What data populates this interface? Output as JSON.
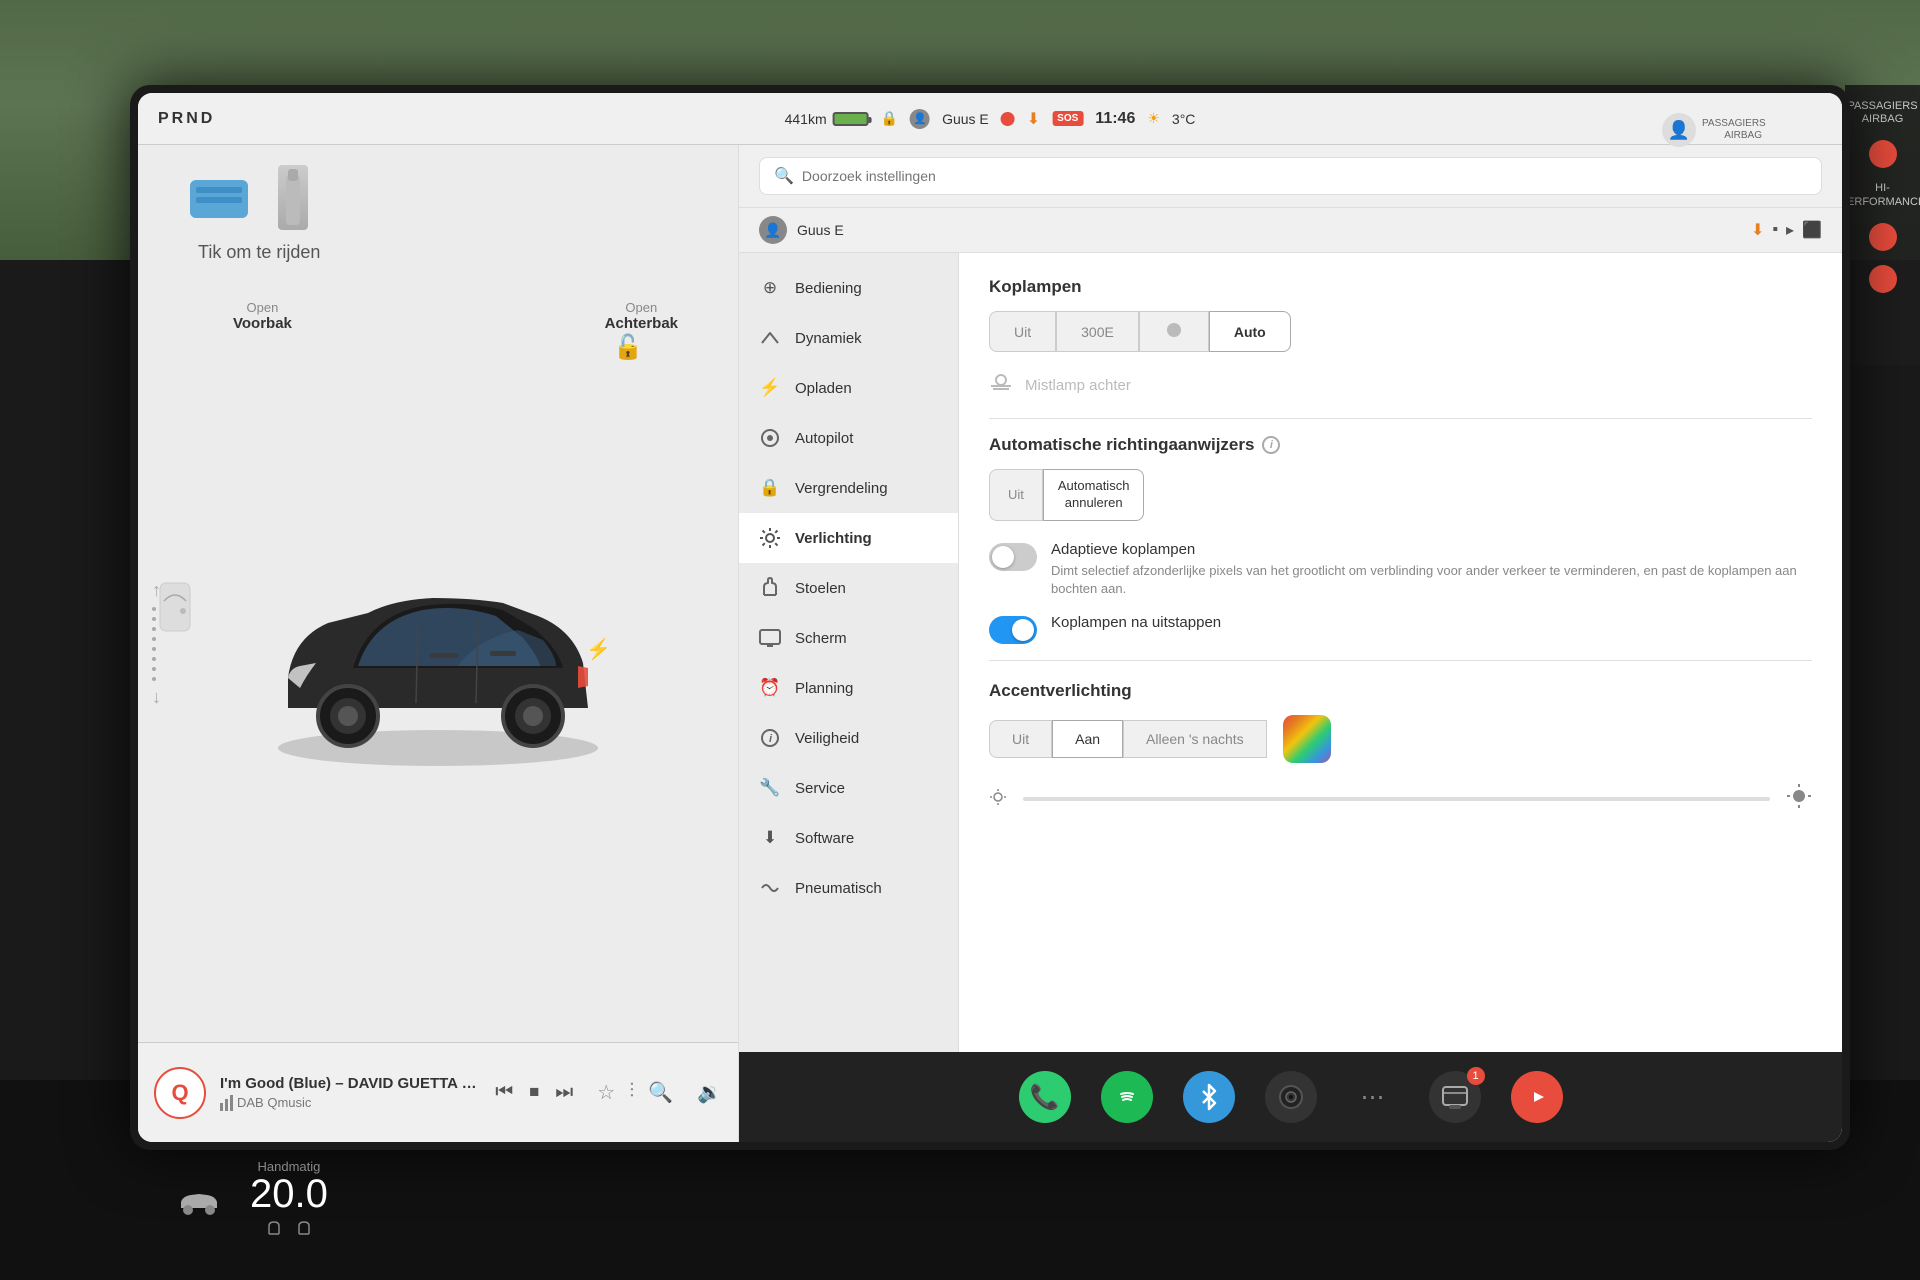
{
  "status_bar": {
    "prnd": "PRND",
    "range": "441km",
    "user": "Guus E",
    "time": "11:46",
    "temp": "3°C"
  },
  "car_panel": {
    "tik_om_te_rijden": "Tik om te rijden",
    "open_voorbak": "Open",
    "voorbak": "Voorbak",
    "open_achterbak": "Open",
    "achterbak": "Achterbak"
  },
  "music": {
    "title": "I'm Good (Blue) – DAVID GUETTA & BEBE REXHA",
    "station": "DAB Qmusic",
    "logo": "Q"
  },
  "settings": {
    "search_placeholder": "Doorzoek instellingen",
    "user": "Guus E",
    "nav_items": [
      {
        "id": "bediening",
        "label": "Bediening",
        "icon": "⊕"
      },
      {
        "id": "dynamiek",
        "label": "Dynamiek",
        "icon": "🚗"
      },
      {
        "id": "opladen",
        "label": "Opladen",
        "icon": "⚡"
      },
      {
        "id": "autopilot",
        "label": "Autopilot",
        "icon": "◎"
      },
      {
        "id": "vergrendeling",
        "label": "Vergrendeling",
        "icon": "🔒"
      },
      {
        "id": "verlichting",
        "label": "Verlichting",
        "icon": "✦"
      },
      {
        "id": "stoelen",
        "label": "Stoelen",
        "icon": "💺"
      },
      {
        "id": "scherm",
        "label": "Scherm",
        "icon": "📺"
      },
      {
        "id": "planning",
        "label": "Planning",
        "icon": "⏰"
      },
      {
        "id": "veiligheid",
        "label": "Veiligheid",
        "icon": "ℹ"
      },
      {
        "id": "service",
        "label": "Service",
        "icon": "🔧"
      },
      {
        "id": "software",
        "label": "Software",
        "icon": "⬇"
      },
      {
        "id": "pneumatisch",
        "label": "Pneumatisch",
        "icon": "∿"
      }
    ],
    "active_nav": "verlichting",
    "sections": {
      "koplampen": {
        "title": "Koplampen",
        "options": [
          "Uit",
          "300E",
          "⬤D",
          "Auto"
        ],
        "active": "Auto"
      },
      "mistlamp": {
        "label": "Mistlamp achter"
      },
      "richtingaanwijzers": {
        "title": "Automatische richtingaanwijzers",
        "options": [
          "Uit",
          "Automatisch\nannuleren"
        ],
        "active": "Automatisch annuleren"
      },
      "adaptieve_koplampen": {
        "title": "Adaptieve koplampen",
        "desc": "Dimt selectief afzonderlijke pixels van het grootlicht om verblinding voor ander verkeer te verminderen, en past de koplampen aan bochten aan.",
        "enabled": false
      },
      "koplampen_na_uitstappen": {
        "title": "Koplampen na uitstappen",
        "enabled": true
      },
      "accentverlichting": {
        "title": "Accentverlichting",
        "options": [
          "Uit",
          "Aan",
          "Alleen 's nachts"
        ],
        "active": "Aan"
      }
    }
  },
  "taskbar": {
    "icons": [
      "phone",
      "spotify",
      "bluetooth",
      "camera",
      "dots",
      "notification",
      "youtube"
    ]
  },
  "bottom": {
    "handmatig": "Handmatig",
    "temp": "20.0"
  },
  "side_panel": {
    "label1": "PASSAGIERS AIRBAG",
    "label2": "HI-PERFORMANCE"
  }
}
